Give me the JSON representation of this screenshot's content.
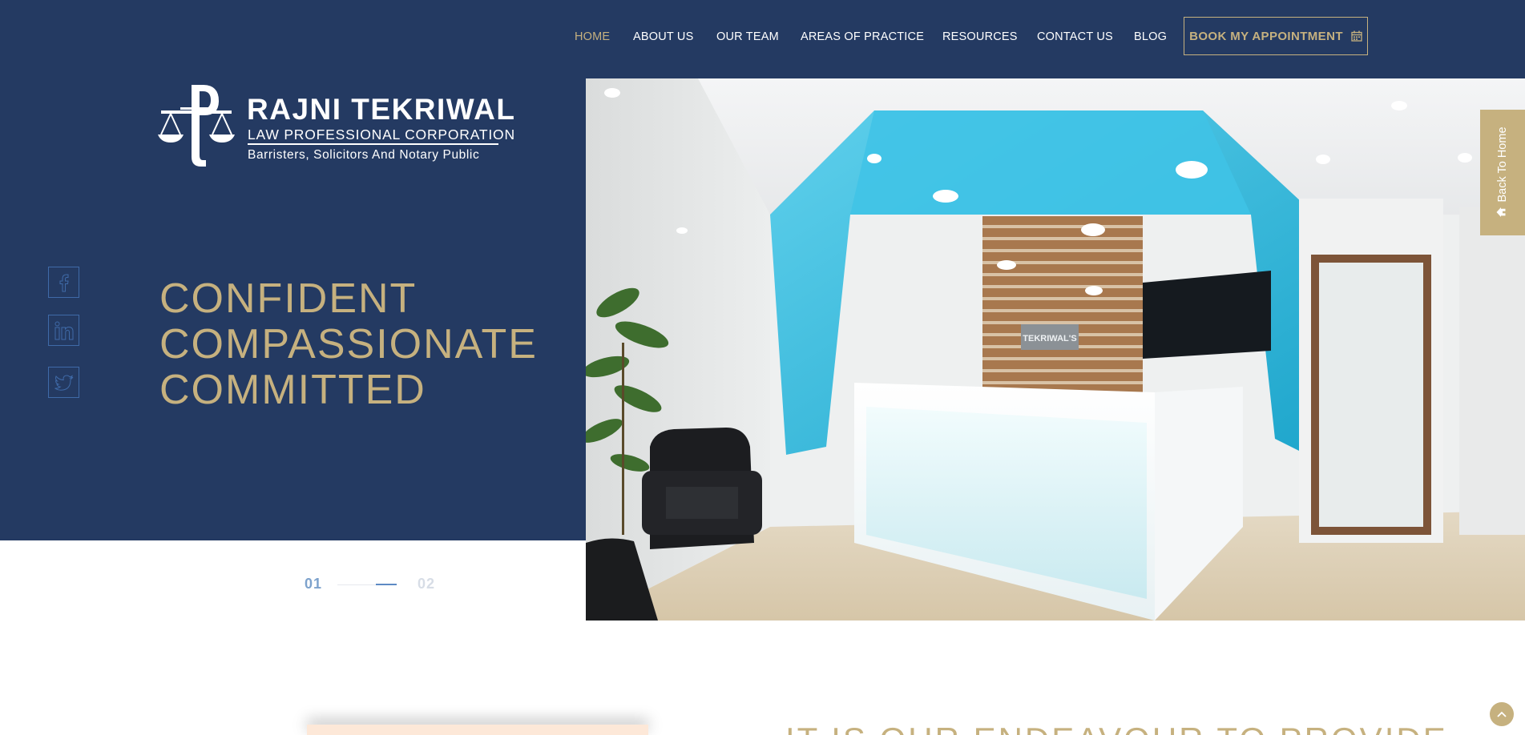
{
  "nav": {
    "items": [
      {
        "label": "HOME",
        "active": true
      },
      {
        "label": "ABOUT US"
      },
      {
        "label": "OUR TEAM"
      },
      {
        "label": "AREAS OF PRACTICE"
      },
      {
        "label": "RESOURCES"
      },
      {
        "label": "CONTACT US"
      },
      {
        "label": "BLOG"
      }
    ],
    "book_label": "BOOK MY APPOINTMENT",
    "book_icon": "calendar-icon"
  },
  "logo": {
    "title": "RAJNI TEKRIWAL",
    "subtitle": "LAW PROFESSIONAL CORPORATION",
    "tagline": "Barristers, Solicitors And Notary Public"
  },
  "hero": {
    "lines": [
      "CONFIDENT",
      "COMPASSIONATE",
      "COMMITTED"
    ],
    "slides": [
      "01",
      "02"
    ],
    "active_slide": 1,
    "photo_sign": "TEKRIWAL'S"
  },
  "social": [
    "facebook-icon",
    "linkedin-icon",
    "twitter-icon"
  ],
  "back_home_label": "Back To Home",
  "bottom_heading": "IT IS OUR ENDEAVOUR TO PROVIDE",
  "colors": {
    "navy": "#243a62",
    "gold": "#c6b17f",
    "accent_blue": "#5d8ac4",
    "teal": "#2fb4d8"
  }
}
